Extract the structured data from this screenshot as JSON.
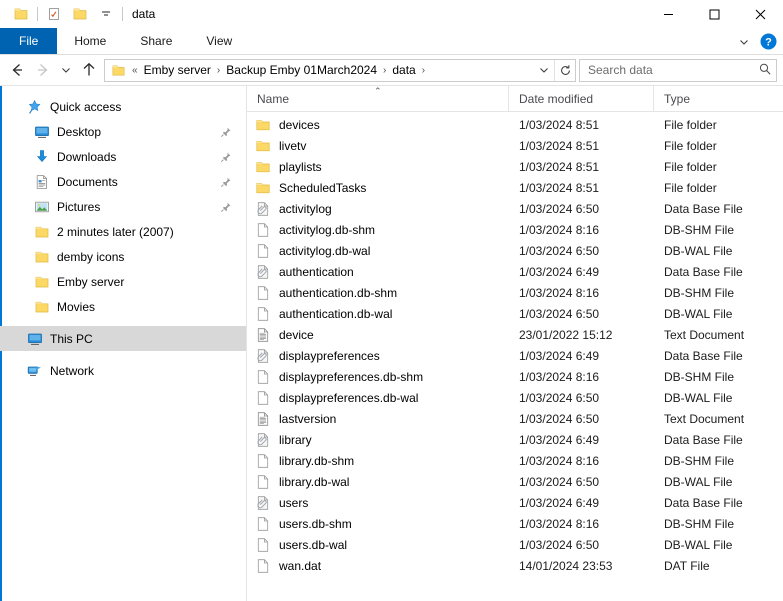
{
  "window": {
    "title": "data",
    "quick_access_toolbar": [
      {
        "name": "folder-icon",
        "label": "Folder"
      },
      {
        "name": "properties-icon",
        "label": "Properties"
      },
      {
        "name": "new-folder-icon",
        "label": "New folder"
      },
      {
        "name": "chevron-down-icon",
        "label": "Customize Quick Access Toolbar"
      }
    ],
    "controls": {
      "minimize": "—",
      "maximize": "□",
      "close": "✕"
    }
  },
  "ribbon": {
    "tabs": [
      {
        "label": "File",
        "active": true
      },
      {
        "label": "Home",
        "active": false
      },
      {
        "label": "Share",
        "active": false
      },
      {
        "label": "View",
        "active": false
      }
    ],
    "collapse_label": "Minimize the Ribbon",
    "help_label": "Help"
  },
  "addressbar": {
    "back_label": "Back",
    "forward_label": "Forward",
    "recent_label": "Recent locations",
    "up_label": "Up",
    "overflow": "«",
    "crumbs": [
      {
        "label": "Emby server"
      },
      {
        "label": "Backup Emby 01March2024"
      },
      {
        "label": "data"
      }
    ],
    "separator": "›",
    "dropdown_label": "Previous locations",
    "refresh_label": "Refresh"
  },
  "search": {
    "placeholder": "Search data",
    "value": "",
    "icon": "search-icon"
  },
  "sidebar": {
    "groups": [
      {
        "header": {
          "label": "Quick access",
          "icon": "star-pin-icon"
        },
        "items": [
          {
            "label": "Desktop",
            "icon": "desktop-icon",
            "pinned": true
          },
          {
            "label": "Downloads",
            "icon": "downloads-icon",
            "pinned": true
          },
          {
            "label": "Documents",
            "icon": "documents-icon",
            "pinned": true
          },
          {
            "label": "Pictures",
            "icon": "pictures-icon",
            "pinned": true
          },
          {
            "label": "2 minutes later (2007)",
            "icon": "folder-icon",
            "pinned": false
          },
          {
            "label": "demby icons",
            "icon": "folder-icon",
            "pinned": false
          },
          {
            "label": "Emby server",
            "icon": "folder-icon",
            "pinned": false
          },
          {
            "label": "Movies",
            "icon": "folder-icon",
            "pinned": false
          }
        ]
      }
    ],
    "this_pc": {
      "label": "This PC",
      "icon": "this-pc-icon",
      "selected": true
    },
    "network": {
      "label": "Network",
      "icon": "network-icon",
      "selected": false
    }
  },
  "filelist": {
    "columns": [
      {
        "key": "name",
        "label": "Name",
        "sorted": "asc",
        "sort_caret": "⌃"
      },
      {
        "key": "date",
        "label": "Date modified",
        "sorted": null
      },
      {
        "key": "type",
        "label": "Type",
        "sorted": null
      }
    ],
    "rows": [
      {
        "name": "devices",
        "date": "1/03/2024 8:51",
        "type": "File folder",
        "icon": "folder-icon"
      },
      {
        "name": "livetv",
        "date": "1/03/2024 8:51",
        "type": "File folder",
        "icon": "folder-icon"
      },
      {
        "name": "playlists",
        "date": "1/03/2024 8:51",
        "type": "File folder",
        "icon": "folder-icon"
      },
      {
        "name": "ScheduledTasks",
        "date": "1/03/2024 8:51",
        "type": "File folder",
        "icon": "folder-icon"
      },
      {
        "name": "activitylog",
        "date": "1/03/2024 6:50",
        "type": "Data Base File",
        "icon": "database-file-icon"
      },
      {
        "name": "activitylog.db-shm",
        "date": "1/03/2024 8:16",
        "type": "DB-SHM File",
        "icon": "blank-file-icon"
      },
      {
        "name": "activitylog.db-wal",
        "date": "1/03/2024 6:50",
        "type": "DB-WAL File",
        "icon": "blank-file-icon"
      },
      {
        "name": "authentication",
        "date": "1/03/2024 6:49",
        "type": "Data Base File",
        "icon": "database-file-icon"
      },
      {
        "name": "authentication.db-shm",
        "date": "1/03/2024 8:16",
        "type": "DB-SHM File",
        "icon": "blank-file-icon"
      },
      {
        "name": "authentication.db-wal",
        "date": "1/03/2024 6:50",
        "type": "DB-WAL File",
        "icon": "blank-file-icon"
      },
      {
        "name": "device",
        "date": "23/01/2022 15:12",
        "type": "Text Document",
        "icon": "text-document-icon"
      },
      {
        "name": "displaypreferences",
        "date": "1/03/2024 6:49",
        "type": "Data Base File",
        "icon": "database-file-icon"
      },
      {
        "name": "displaypreferences.db-shm",
        "date": "1/03/2024 8:16",
        "type": "DB-SHM File",
        "icon": "blank-file-icon"
      },
      {
        "name": "displaypreferences.db-wal",
        "date": "1/03/2024 6:50",
        "type": "DB-WAL File",
        "icon": "blank-file-icon"
      },
      {
        "name": "lastversion",
        "date": "1/03/2024 6:50",
        "type": "Text Document",
        "icon": "text-document-icon"
      },
      {
        "name": "library",
        "date": "1/03/2024 6:49",
        "type": "Data Base File",
        "icon": "database-file-icon"
      },
      {
        "name": "library.db-shm",
        "date": "1/03/2024 8:16",
        "type": "DB-SHM File",
        "icon": "blank-file-icon"
      },
      {
        "name": "library.db-wal",
        "date": "1/03/2024 6:50",
        "type": "DB-WAL File",
        "icon": "blank-file-icon"
      },
      {
        "name": "users",
        "date": "1/03/2024 6:49",
        "type": "Data Base File",
        "icon": "database-file-icon"
      },
      {
        "name": "users.db-shm",
        "date": "1/03/2024 8:16",
        "type": "DB-SHM File",
        "icon": "blank-file-icon"
      },
      {
        "name": "users.db-wal",
        "date": "1/03/2024 6:50",
        "type": "DB-WAL File",
        "icon": "blank-file-icon"
      },
      {
        "name": "wan.dat",
        "date": "14/01/2024 23:53",
        "type": "DAT File",
        "icon": "blank-file-icon"
      }
    ]
  },
  "colors": {
    "accent": "#0063b1",
    "folder": "#fcd966",
    "selection": "#cce8ff",
    "nav_selected": "#d8d8d8",
    "help_blue": "#0078d7"
  }
}
